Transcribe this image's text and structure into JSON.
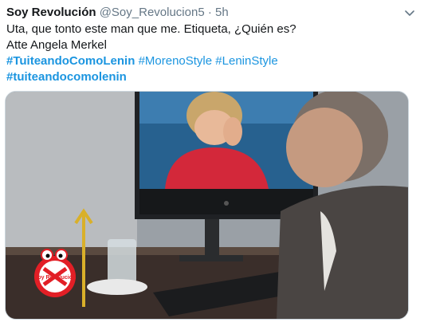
{
  "tweet": {
    "author_name": "Soy Revolución",
    "handle": "@Soy_Revolucion5",
    "separator": "·",
    "time": "5h",
    "text_line1": "Uta, que tonto este man que me. Etiqueta, ¿Quién es?",
    "text_line2": "Atte Angela Merkel",
    "hashtags": [
      "#TuiteandoComoLenin",
      "#MorenoStyle",
      "#LeninStyle",
      "#tuiteandocomolenin"
    ],
    "menu_icon": "chevron-down-icon",
    "media_watermark": "Soy Revolución"
  },
  "colors": {
    "link": "#1b95e0",
    "text": "#14171a",
    "secondary": "#657786"
  }
}
